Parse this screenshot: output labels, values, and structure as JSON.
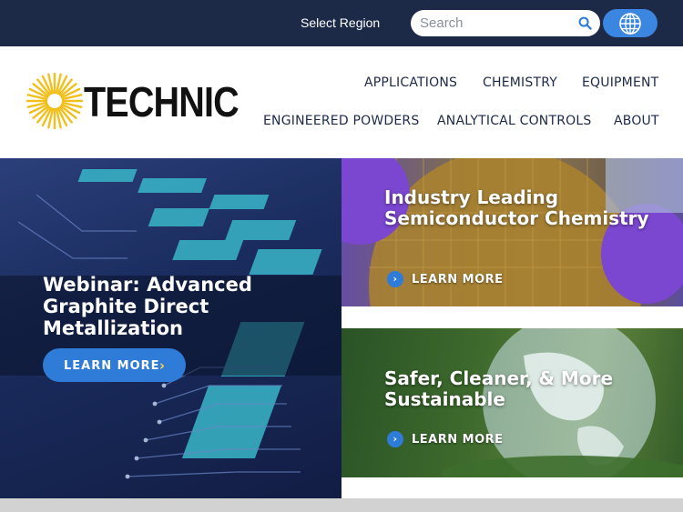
{
  "topbar": {
    "region_label": "Select Region",
    "search_placeholder": "Search",
    "search_icon": "search-icon",
    "globe_icon": "globe-icon",
    "background": "#1c2a47",
    "accent": "#3a86e0"
  },
  "logo": {
    "text": "TECHNIC",
    "sun_color": "#f2c01c"
  },
  "nav": {
    "row1": [
      "APPLICATIONS",
      "CHEMISTRY",
      "EQUIPMENT"
    ],
    "row2": [
      "ENGINEERED POWDERS",
      "ANALYTICAL CONTROLS",
      "ABOUT"
    ]
  },
  "hero": {
    "title": "Webinar: Advanced Graphite Direct Metallization",
    "cta_label": "LEARN MORE",
    "cta_chevron": "›"
  },
  "tiles": [
    {
      "title": "Industry Leading Semiconductor Chemistry",
      "link_label": "LEARN MORE",
      "link_icon": "chevron-circle-icon"
    },
    {
      "title": "Safer, Cleaner, & More Sustainable",
      "link_label": "LEARN MORE",
      "link_icon": "chevron-circle-icon"
    }
  ]
}
